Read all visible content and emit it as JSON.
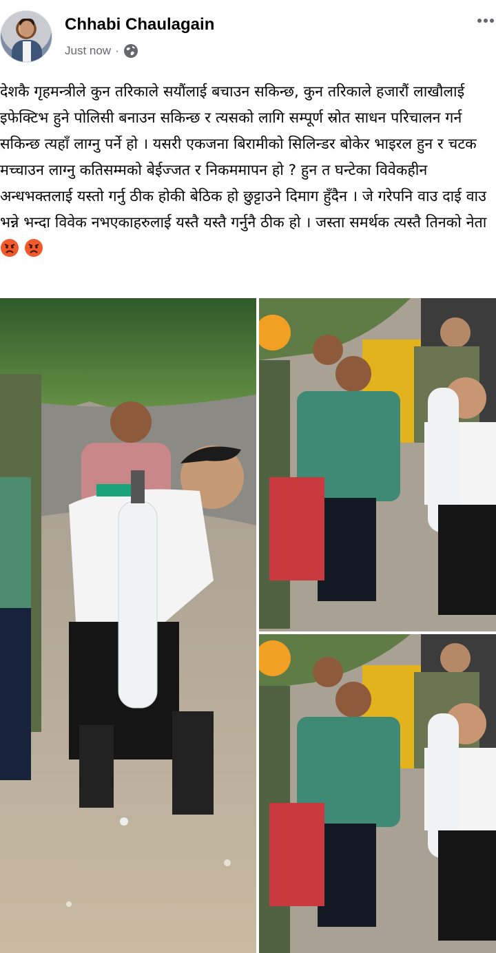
{
  "post": {
    "author": "Chhabi Chaulagain",
    "timestamp": "Just now",
    "timestamp_separator": "·",
    "privacy_icon": "globe-icon",
    "more_icon": "more-options-icon",
    "text": "देशकै गृहमन्त्रीले कुन तरिकाले सयौंलाई बचाउन सकिन्छ,  कुन तरिकाले हजारौं लाखौलाई इफेक्टिभ हुने पोलिसी बनाउन सकिन्छ र त्यसको लागि सम्पूर्ण स्रोत साधन परिचालन गर्न सकिन्छ  त्यहाँ लाग्नु पर्ने हो । यसरी एकजना बिरामीको सिलिन्डर बोकेर भाइरल हुन र चटक मच्चाउन लाग्नु कतिसम्मको बेईज्जत र निकममापन हो ? हुन त घन्टेका विवेकहीन अन्धभक्तलाई यस्तो गर्नु ठीक होकी बेठिक हो छुट्टाउने दिमाग हुँदैन । जे गरेपनि वाउ दाई वाउ भन्ने भन्दा विवेक नभएकाहरुलाई यस्तै यस्तै गर्नुनै ठीक हो । जस्ता समर्थक त्यस्तै तिनको नेता",
    "trailing_emoji": "angry-face-emoji"
  },
  "colors": {
    "meta_text": "#65676b",
    "emoji_face": "#f0592a"
  }
}
